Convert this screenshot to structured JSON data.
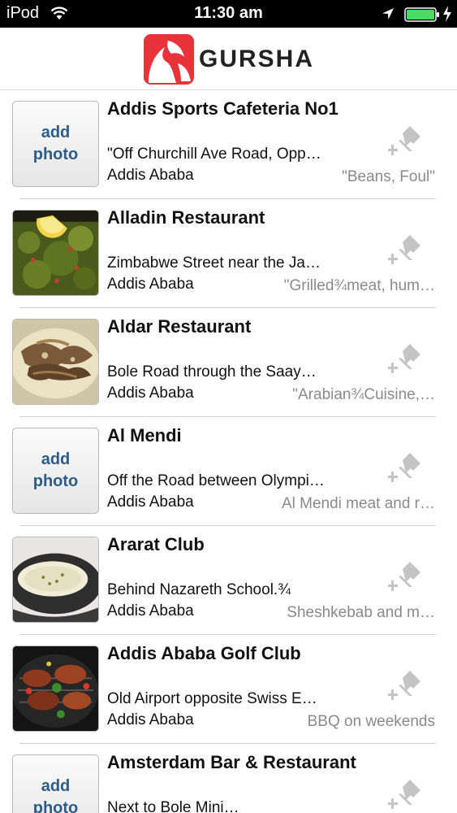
{
  "status_bar": {
    "carrier": "iPod",
    "time": "11:30 am",
    "icons": [
      "wifi-icon",
      "location-icon",
      "battery-icon",
      "charging-icon"
    ]
  },
  "header": {
    "logo_text": "GURSHA",
    "brand_color": "#e8333a"
  },
  "add_photo": {
    "line1": "add",
    "line2": "photo"
  },
  "restaurants": [
    {
      "name": "Addis Sports Cafeteria No1",
      "address": "\"Off Churchill Ave Road, Opp…",
      "city": "Addis Ababa",
      "note": "\"Beans, Foul\"",
      "photo": "add-photo"
    },
    {
      "name": "Alladin Restaurant",
      "address": "Zimbabwe Street near the Ja…",
      "city": "Addis Ababa",
      "note": "\"Grilled¾meat, hum…",
      "photo": "tabbouleh-photo"
    },
    {
      "name": "Aldar Restaurant",
      "address": "Bole Road through the Saay…",
      "city": "Addis Ababa",
      "note": "\"Arabian¾Cuisine,…",
      "photo": "shawarma-photo"
    },
    {
      "name": "Al Mendi",
      "address": "Off the Road between Olympi…",
      "city": "Addis Ababa",
      "note": "Al Mendi meat and r…",
      "photo": "add-photo"
    },
    {
      "name": "Ararat Club",
      "address": "Behind Nazareth School.¾",
      "city": "Addis Ababa",
      "note": "Sheshkebab and m…",
      "photo": "soup-photo"
    },
    {
      "name": "Addis Ababa Golf Club",
      "address": "Old Airport opposite Swiss E…",
      "city": "Addis Ababa",
      "note": "BBQ on weekends",
      "photo": "bbq-photo"
    },
    {
      "name": "Amsterdam Bar & Restaurant",
      "address": "Next to Bole Mini…",
      "city": "",
      "note": "",
      "photo": "add-photo"
    }
  ]
}
